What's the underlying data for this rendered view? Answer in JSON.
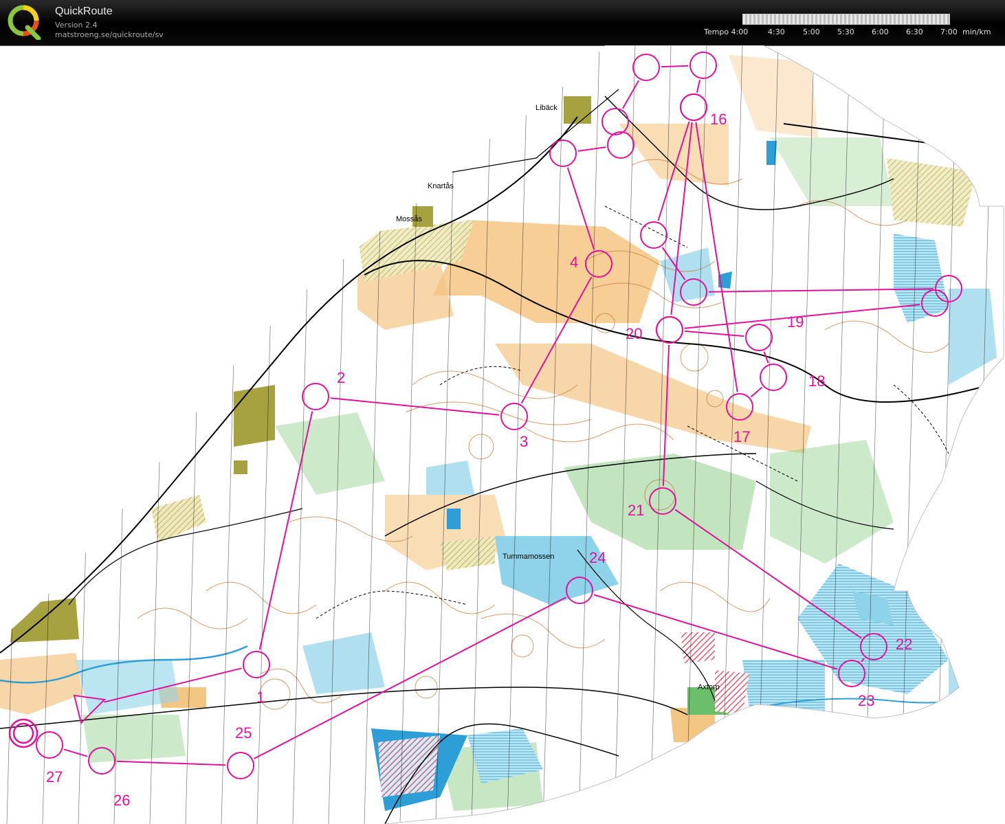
{
  "app": {
    "title": "QuickRoute",
    "version": "Version 2.4",
    "url": "matstroeng.se/quickroute/sv"
  },
  "tempo": {
    "label": "Tempo 4:00",
    "ticks": [
      "4:30",
      "5:00",
      "5:30",
      "6:00",
      "6:30",
      "7:00"
    ],
    "unit": "min/km"
  },
  "colors": {
    "course": "#e0119b",
    "forest": "#ffffff",
    "open_land": "#f4c684",
    "green": "#8fd08a",
    "water": "#8fd3ea",
    "contour": "#c87a3c",
    "settlement": "#a6a23f",
    "private": "#e8566f"
  },
  "map": {
    "place_names": [
      "Libäck",
      "Knartås",
      "Mossås",
      "Tummamossen",
      "Axtorp"
    ]
  },
  "course": {
    "controls": [
      {
        "label": "1"
      },
      {
        "label": "2"
      },
      {
        "label": "3"
      },
      {
        "label": "4"
      },
      {
        "label": ""
      },
      {
        "label": ""
      },
      {
        "label": ""
      },
      {
        "label": ""
      },
      {
        "label": ""
      },
      {
        "label": ""
      },
      {
        "label": ""
      },
      {
        "label": ""
      },
      {
        "label": ""
      },
      {
        "label": ""
      },
      {
        "label": ""
      },
      {
        "label": "16"
      },
      {
        "label": "17"
      },
      {
        "label": "18"
      },
      {
        "label": "19"
      },
      {
        "label": "20"
      },
      {
        "label": "21"
      },
      {
        "label": "22"
      },
      {
        "label": "23"
      },
      {
        "label": "24"
      },
      {
        "label": "25"
      },
      {
        "label": "26"
      },
      {
        "label": "27"
      }
    ]
  }
}
